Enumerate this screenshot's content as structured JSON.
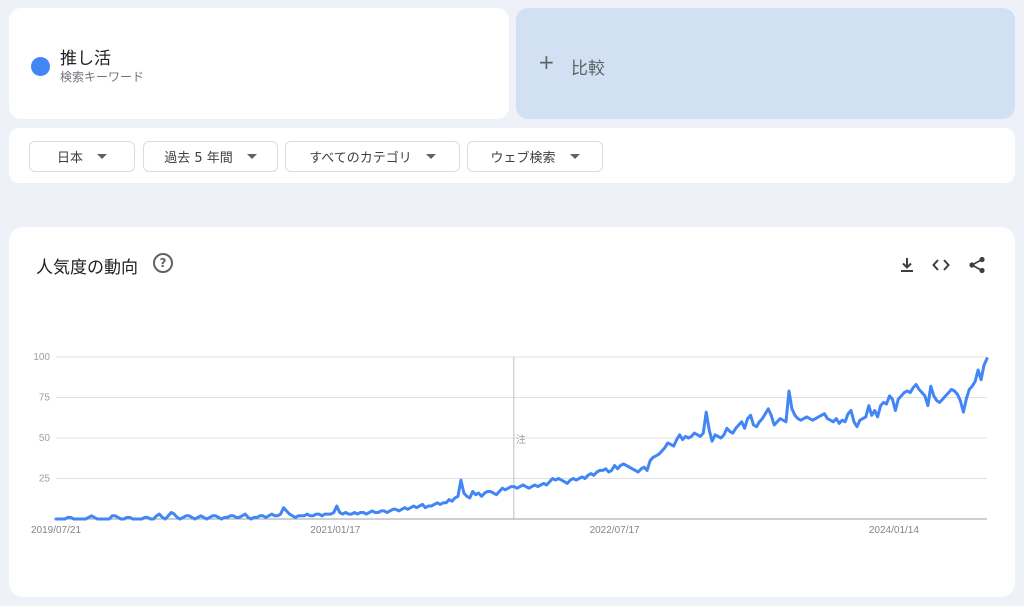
{
  "term": {
    "name": "推し活",
    "type": "検索キーワード",
    "color": "#4285f4"
  },
  "compare": {
    "plus": "+",
    "label": "比較"
  },
  "filters": {
    "region": "日本",
    "period": "過去 5 年間",
    "category": "すべてのカテゴリ",
    "search_type": "ウェブ検索"
  },
  "chart_header": {
    "title": "人気度の動向",
    "help_icon": "help-circle-icon",
    "actions": [
      "download-icon",
      "embed-code-icon",
      "share-icon"
    ]
  },
  "chart_data": {
    "type": "line",
    "title": "人気度の動向",
    "xlabel": "",
    "ylabel": "",
    "ylim": [
      0,
      100
    ],
    "y_ticks": [
      "100",
      "75",
      "50",
      "25"
    ],
    "x_tick_labels": [
      "2019/07/21",
      "2021/01/17",
      "2022/07/17",
      "2024/01/14"
    ],
    "x_start": "2019/07/21",
    "x_end": "2024/07/14",
    "grid": true,
    "annotation": {
      "label": "注",
      "date": "2022/01/01"
    },
    "series": [
      {
        "color": "#4285f4",
        "values": [
          0,
          0,
          0,
          0,
          1,
          1,
          0,
          0,
          0,
          0,
          0,
          1,
          2,
          1,
          0,
          0,
          0,
          0,
          0,
          2,
          2,
          1,
          0,
          0,
          1,
          1,
          0,
          0,
          0,
          0,
          1,
          1,
          0,
          0,
          2,
          3,
          1,
          0,
          2,
          4,
          3,
          1,
          0,
          1,
          2,
          2,
          1,
          0,
          1,
          2,
          1,
          0,
          1,
          2,
          2,
          1,
          0,
          1,
          1,
          2,
          2,
          1,
          1,
          2,
          3,
          1,
          0,
          1,
          1,
          2,
          2,
          1,
          2,
          3,
          2,
          2,
          3,
          7,
          5,
          3,
          2,
          1,
          2,
          2,
          2,
          3,
          2,
          2,
          3,
          3,
          2,
          3,
          3,
          3,
          4,
          8,
          4,
          3,
          4,
          3,
          3,
          4,
          3,
          4,
          4,
          3,
          4,
          5,
          4,
          4,
          5,
          5,
          4,
          5,
          6,
          6,
          5,
          6,
          7,
          6,
          7,
          8,
          7,
          8,
          9,
          7,
          8,
          8,
          9,
          10,
          9,
          10,
          10,
          12,
          11,
          13,
          14,
          24,
          16,
          14,
          13,
          17,
          15,
          16,
          14,
          16,
          17,
          17,
          16,
          15,
          17,
          19,
          18,
          19,
          20,
          20,
          19,
          20,
          21,
          20,
          19,
          20,
          21,
          20,
          21,
          22,
          21,
          23,
          25,
          24,
          25,
          24,
          23,
          22,
          24,
          25,
          24,
          25,
          26,
          25,
          27,
          28,
          27,
          29,
          30,
          30,
          31,
          29,
          30,
          33,
          31,
          33,
          34,
          33,
          32,
          31,
          30,
          29,
          31,
          32,
          30,
          36,
          38,
          39,
          40,
          42,
          44,
          47,
          46,
          45,
          49,
          52,
          49,
          51,
          50,
          51,
          53,
          52,
          51,
          53,
          66,
          55,
          48,
          52,
          51,
          50,
          52,
          56,
          54,
          53,
          56,
          58,
          60,
          56,
          62,
          64,
          58,
          57,
          60,
          62,
          65,
          68,
          64,
          58,
          60,
          62,
          61,
          60,
          79,
          68,
          64,
          62,
          61,
          62,
          63,
          62,
          61,
          62,
          63,
          64,
          65,
          62,
          61,
          60,
          62,
          59,
          61,
          60,
          65,
          67,
          60,
          57,
          61,
          62,
          63,
          70,
          64,
          67,
          63,
          70,
          72,
          71,
          76,
          74,
          67,
          74,
          76,
          78,
          79,
          78,
          81,
          83,
          80,
          78,
          76,
          70,
          82,
          76,
          73,
          72,
          74,
          76,
          78,
          80,
          79,
          77,
          73,
          66,
          74,
          80,
          82,
          85,
          92,
          86,
          95,
          99
        ]
      }
    ]
  }
}
